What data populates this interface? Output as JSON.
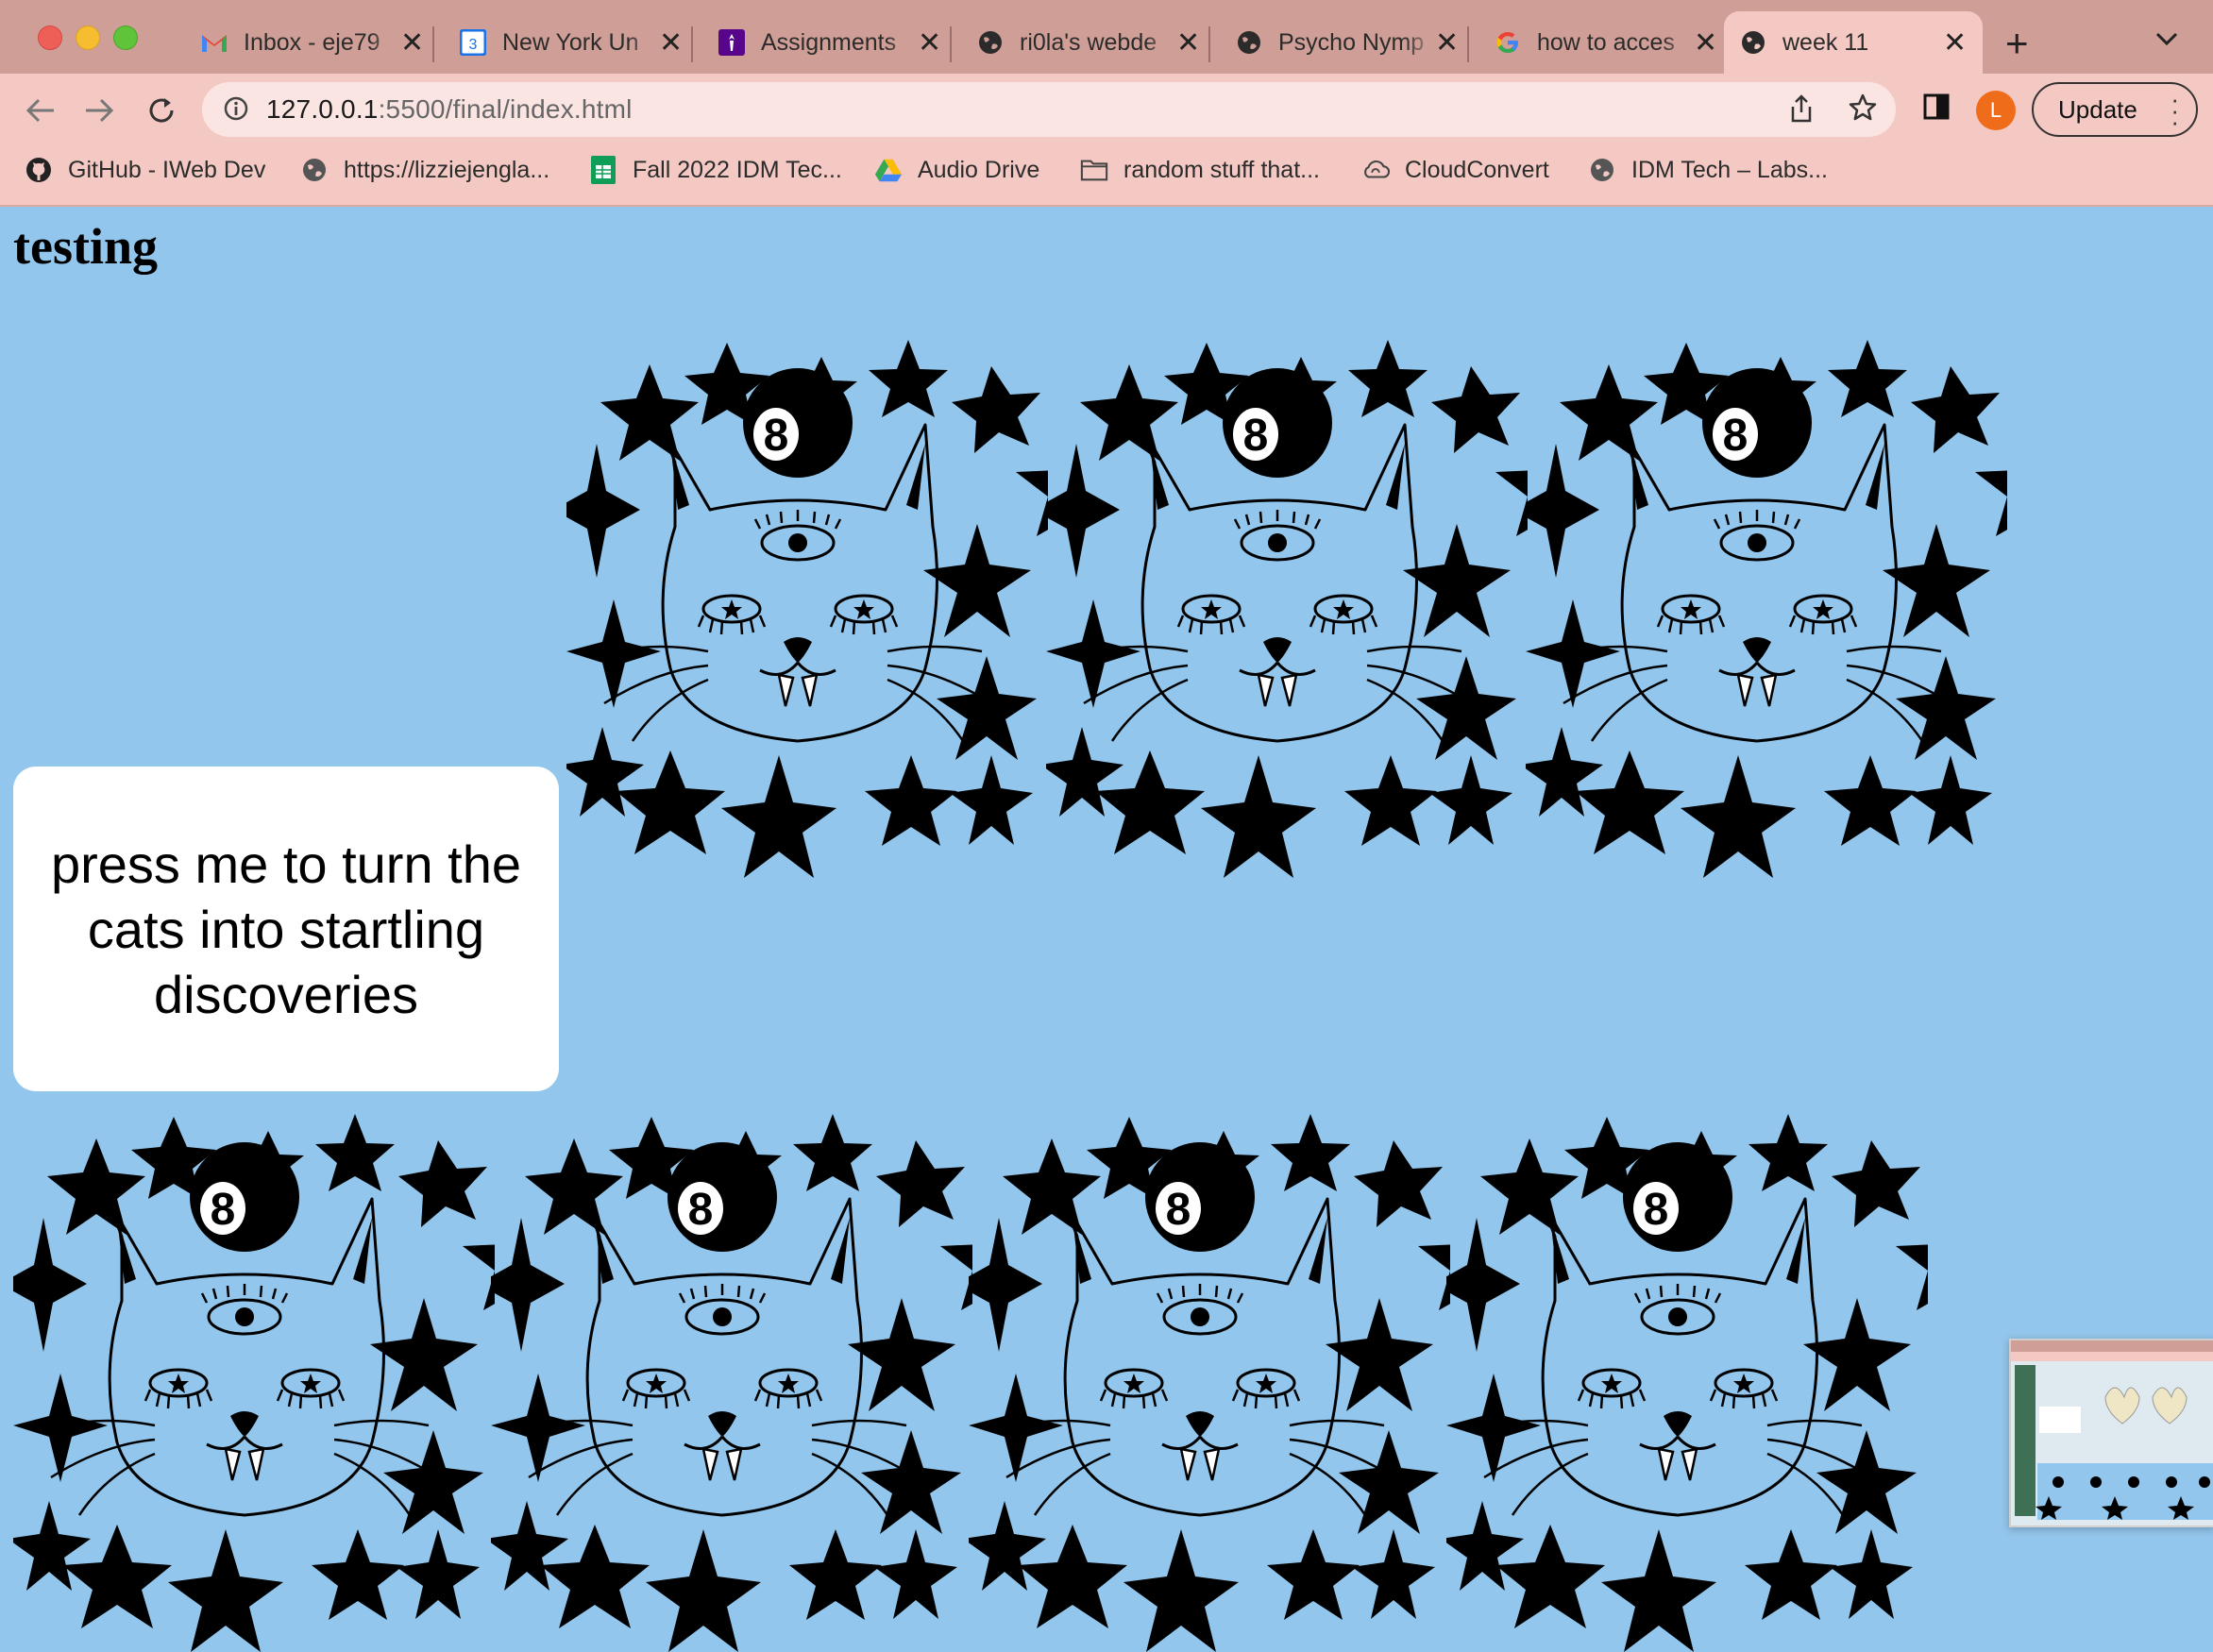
{
  "window": {
    "tabs": [
      {
        "title": "Inbox - eje79",
        "icon": "gmail-icon"
      },
      {
        "title": "New York Un",
        "icon": "google-calendar-icon"
      },
      {
        "title": "Assignments",
        "icon": "nyu-torch-icon"
      },
      {
        "title": "ri0la's webde",
        "icon": "globe-icon"
      },
      {
        "title": "Psycho Nymp",
        "icon": "globe-icon"
      },
      {
        "title": "how to acces",
        "icon": "google-icon"
      },
      {
        "title": "week 11",
        "icon": "globe-icon",
        "active": true
      }
    ],
    "close_glyph": "✕",
    "new_tab_glyph": "+"
  },
  "toolbar": {
    "url_host": "127.0.0.1",
    "url_path": ":5500/final/index.html",
    "profile_initial": "L",
    "update_label": "Update"
  },
  "bookmarks": [
    {
      "label": "GitHub - IWeb Dev",
      "icon": "github-icon"
    },
    {
      "label": "https://lizziejengla...",
      "icon": "globe-icon"
    },
    {
      "label": "Fall 2022 IDM Tec...",
      "icon": "google-sheets-icon"
    },
    {
      "label": "Audio Drive",
      "icon": "google-drive-icon"
    },
    {
      "label": "random stuff that...",
      "icon": "folder-icon"
    },
    {
      "label": "CloudConvert",
      "icon": "cloudconvert-icon"
    },
    {
      "label": "IDM Tech – Labs...",
      "icon": "globe-icon"
    }
  ],
  "page": {
    "title": "testing",
    "button_label": "press me to turn the cats into startling discoveries",
    "cat_badge": "8",
    "background_color": "#93c6ec"
  },
  "colors": {
    "tabstrip": "#cf9e96",
    "toolbar": "#f4c9c3",
    "omnibox": "#fbe5e2",
    "avatar": "#ef6c1a"
  }
}
